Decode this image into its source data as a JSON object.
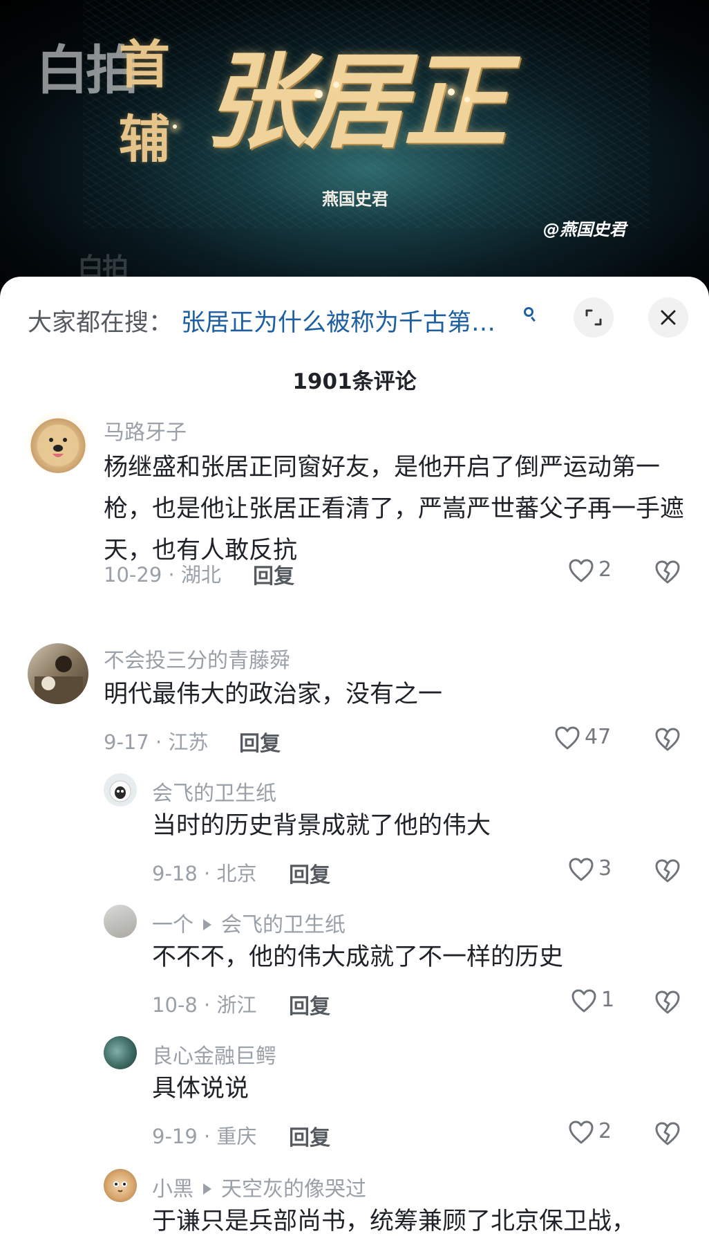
{
  "video": {
    "watermark_logo": "白拍",
    "title_prefix": "首辅",
    "title_main": "张居正",
    "subtitle": "燕国史君",
    "handle": "@燕国史君"
  },
  "search": {
    "prefix": "大家都在搜：",
    "query": "张居正为什么被称为千古第…",
    "search_icon": "search-icon",
    "expand_icon": "expand-icon",
    "close_icon": "close-icon"
  },
  "comment_count": "1901条评论",
  "comments": [
    {
      "username": "马路牙子",
      "text": "杨继盛和张居正同窗好友，是他开启了倒严运动第一枪，也是他让张居正看清了，严嵩严世蕃父子再一手遮天，也有人敢反抗",
      "date_location": "10-29 · 湖北",
      "reply_label": "回复",
      "likes": "2"
    },
    {
      "username": "不会投三分的青藤舜",
      "text": "明代最伟大的政治家，没有之一",
      "date_location": "9-17 · 江苏",
      "reply_label": "回复",
      "likes": "47"
    }
  ],
  "replies": [
    {
      "username": "会飞的卫生纸",
      "reply_to": "",
      "text": "当时的历史背景成就了他的伟大",
      "date_location": "9-18 · 北京",
      "reply_label": "回复",
      "likes": "3"
    },
    {
      "username": "一个",
      "reply_to": "会飞的卫生纸",
      "text": "不不不，他的伟大成就了不一样的历史",
      "date_location": "10-8 · 浙江",
      "reply_label": "回复",
      "likes": "1"
    },
    {
      "username": "良心金融巨鳄",
      "reply_to": "",
      "text": "具体说说",
      "date_location": "9-19 · 重庆",
      "reply_label": "回复",
      "likes": "2"
    },
    {
      "username": "小黑",
      "reply_to": "天空灰的像哭过",
      "text": "于谦只是兵部尚书，统筹兼顾了北京保卫战，",
      "date_location": "",
      "reply_label": "",
      "likes": ""
    }
  ],
  "icons": {
    "like": "heart-icon",
    "dislike": "broken-heart-icon",
    "reply_arrow": "reply-arrow-icon"
  },
  "colors": {
    "link_blue": "#1d5fa3",
    "gold_title": "#f0d39a",
    "muted_text": "#9aa0a8",
    "body_text": "#1f2329"
  }
}
